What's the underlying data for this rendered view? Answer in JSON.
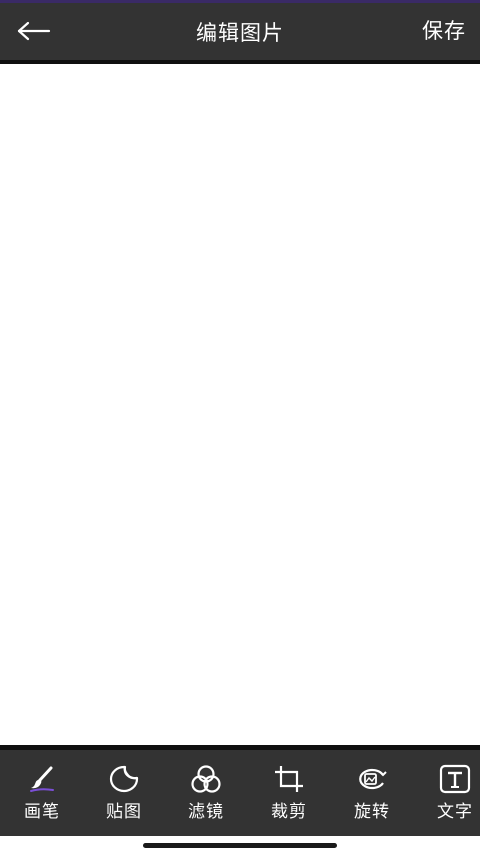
{
  "header": {
    "title": "编辑图片",
    "save_label": "保存"
  },
  "toolbar": {
    "items": [
      {
        "label": "画笔",
        "icon": "brush-icon"
      },
      {
        "label": "贴图",
        "icon": "sticker-icon"
      },
      {
        "label": "滤镜",
        "icon": "filter-icon"
      },
      {
        "label": "裁剪",
        "icon": "crop-icon"
      },
      {
        "label": "旋转",
        "icon": "rotate-icon"
      },
      {
        "label": "文字",
        "icon": "text-icon"
      }
    ]
  },
  "colors": {
    "bar_background": "#333333",
    "accent": "#3a2a66",
    "text": "#ffffff"
  }
}
